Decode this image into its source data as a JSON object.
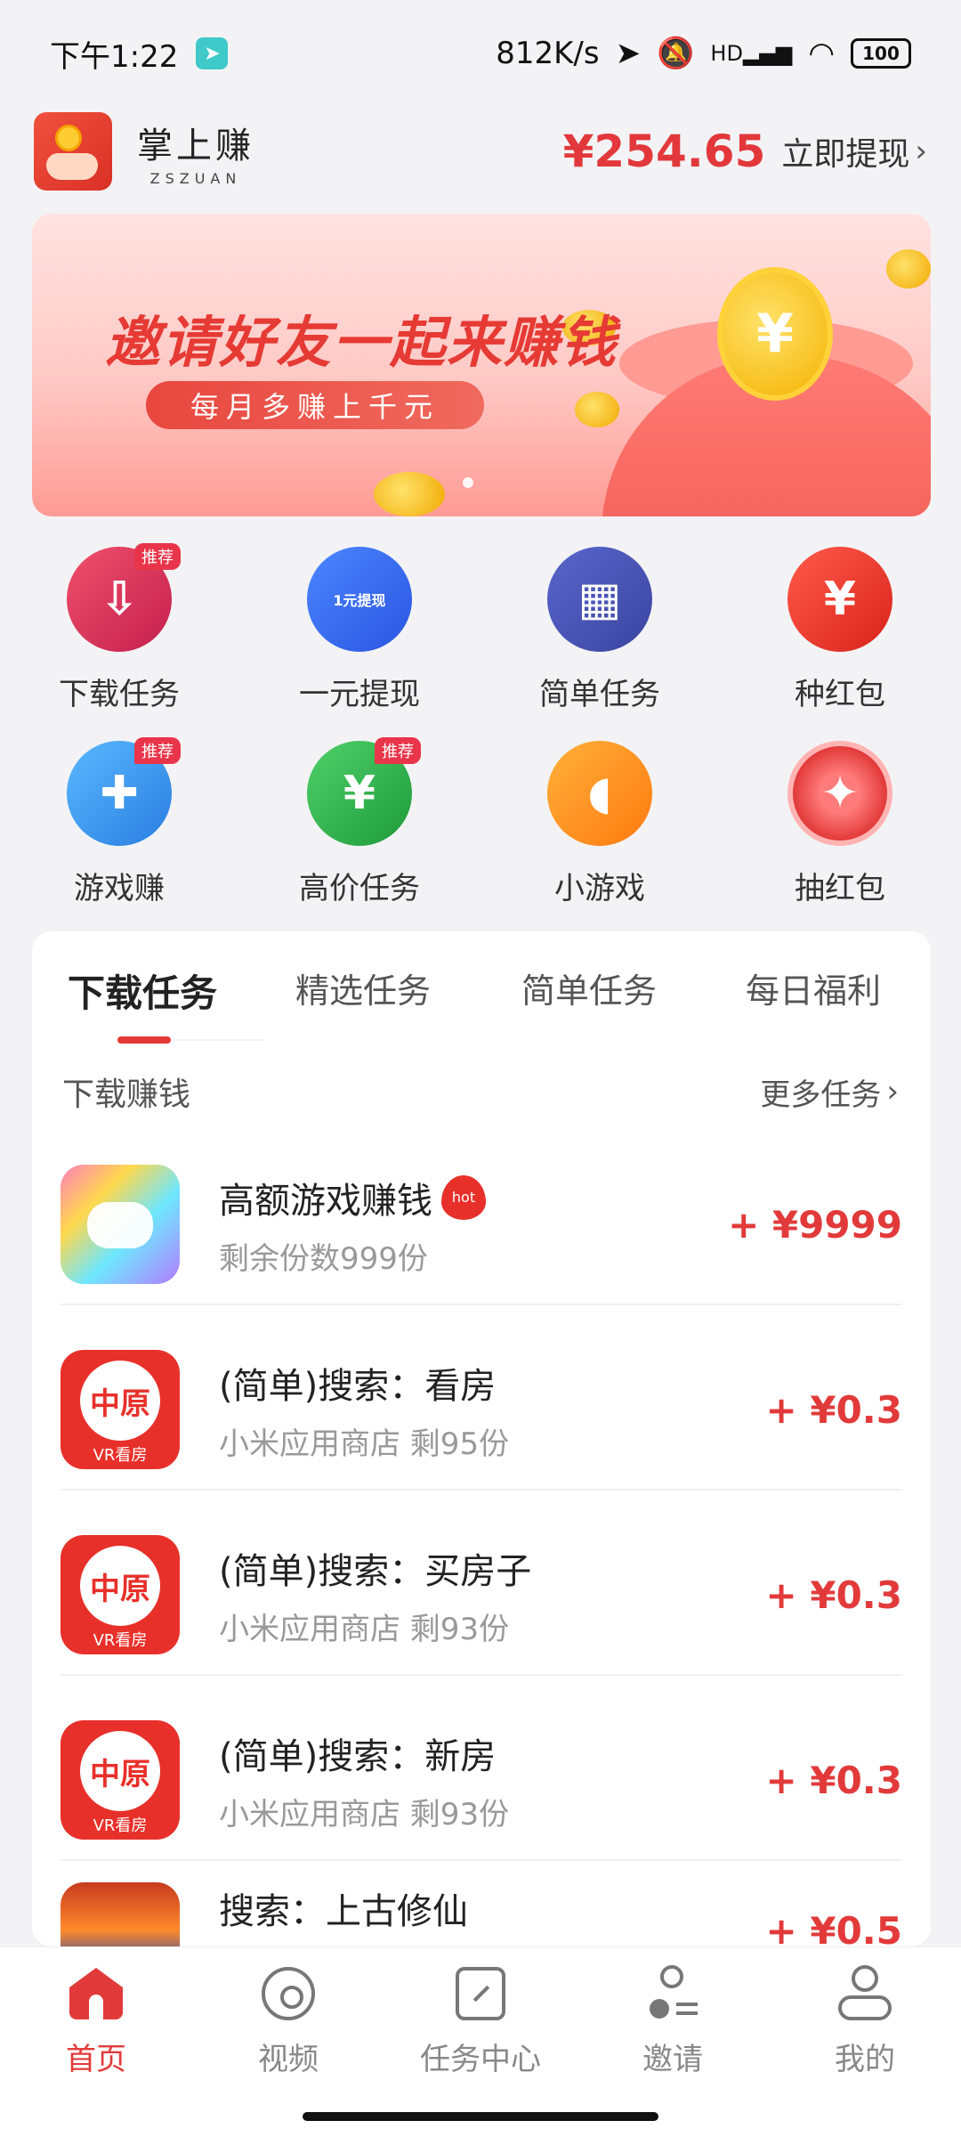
{
  "status_bar": {
    "time": "下午1:22",
    "network_speed": "812K/s",
    "network_type": "HD",
    "battery": "100"
  },
  "header": {
    "app_name": "掌上赚",
    "app_name_sub": "ZSZUAN",
    "balance": "¥254.65",
    "withdraw_label": "立即提现"
  },
  "banner": {
    "title": "邀请好友一起来赚钱",
    "subtitle": "每月多赚上千元",
    "coin_symbol": "¥"
  },
  "shortcuts": [
    {
      "label": "下载任务",
      "icon": "download-icon",
      "tag": "推荐",
      "color": "#e0375f"
    },
    {
      "label": "一元提现",
      "icon": "wallet-icon",
      "tag": "",
      "color": "#3b6cf0",
      "icon_text": "1元提现"
    },
    {
      "label": "简单任务",
      "icon": "calendar-icon",
      "tag": "",
      "color": "#4c57b8"
    },
    {
      "label": "种红包",
      "icon": "plant-icon",
      "tag": "",
      "color": "#e8302a"
    },
    {
      "label": "游戏赚",
      "icon": "gamepad-icon",
      "tag": "推荐",
      "color": "#3aa0f0"
    },
    {
      "label": "高价任务",
      "icon": "price-tag-icon",
      "tag": "推荐",
      "color": "#2fb84c"
    },
    {
      "label": "小游戏",
      "icon": "pacman-icon",
      "tag": "",
      "color": "#ff9326"
    },
    {
      "label": "抽红包",
      "icon": "wheel-icon",
      "tag": "",
      "color": "#ef4f4f"
    }
  ],
  "tabs": [
    {
      "label": "下载任务",
      "active": true
    },
    {
      "label": "精选任务",
      "active": false
    },
    {
      "label": "简单任务",
      "active": false
    },
    {
      "label": "每日福利",
      "active": false
    }
  ],
  "section": {
    "title": "下载赚钱",
    "more_label": "更多任务"
  },
  "tasks": [
    {
      "title": "高额游戏赚钱",
      "hot": "hot",
      "subtitle": "剩余份数999份",
      "reward": "+ ¥9999",
      "icon": "game-app-icon"
    },
    {
      "title": "(简单)搜索：看房",
      "hot": "",
      "subtitle": "小米应用商店 剩95份",
      "reward": "+ ¥0.3",
      "icon": "zhongyuan-app-icon",
      "icon_text": "中原",
      "icon_caption": "VR看房"
    },
    {
      "title": "(简单)搜索：买房子",
      "hot": "",
      "subtitle": "小米应用商店 剩93份",
      "reward": "+ ¥0.3",
      "icon": "zhongyuan-app-icon",
      "icon_text": "中原",
      "icon_caption": "VR看房"
    },
    {
      "title": "(简单)搜索：新房",
      "hot": "",
      "subtitle": "小米应用商店 剩93份",
      "reward": "+ ¥0.3",
      "icon": "zhongyuan-app-icon",
      "icon_text": "中原",
      "icon_caption": "VR看房"
    },
    {
      "title": "搜索：上古修仙",
      "hot": "",
      "subtitle": "",
      "reward": "+ ¥0.5",
      "icon": "fantasy-game-app-icon"
    }
  ],
  "bottom_nav": [
    {
      "label": "首页",
      "icon": "home-icon",
      "active": true
    },
    {
      "label": "视频",
      "icon": "video-icon",
      "active": false
    },
    {
      "label": "任务中心",
      "icon": "task-center-icon",
      "active": false
    },
    {
      "label": "邀请",
      "icon": "invite-icon",
      "active": false
    },
    {
      "label": "我的",
      "icon": "profile-icon",
      "active": false
    }
  ],
  "colors": {
    "accent": "#e23a3a",
    "background": "#f3f3f5"
  }
}
